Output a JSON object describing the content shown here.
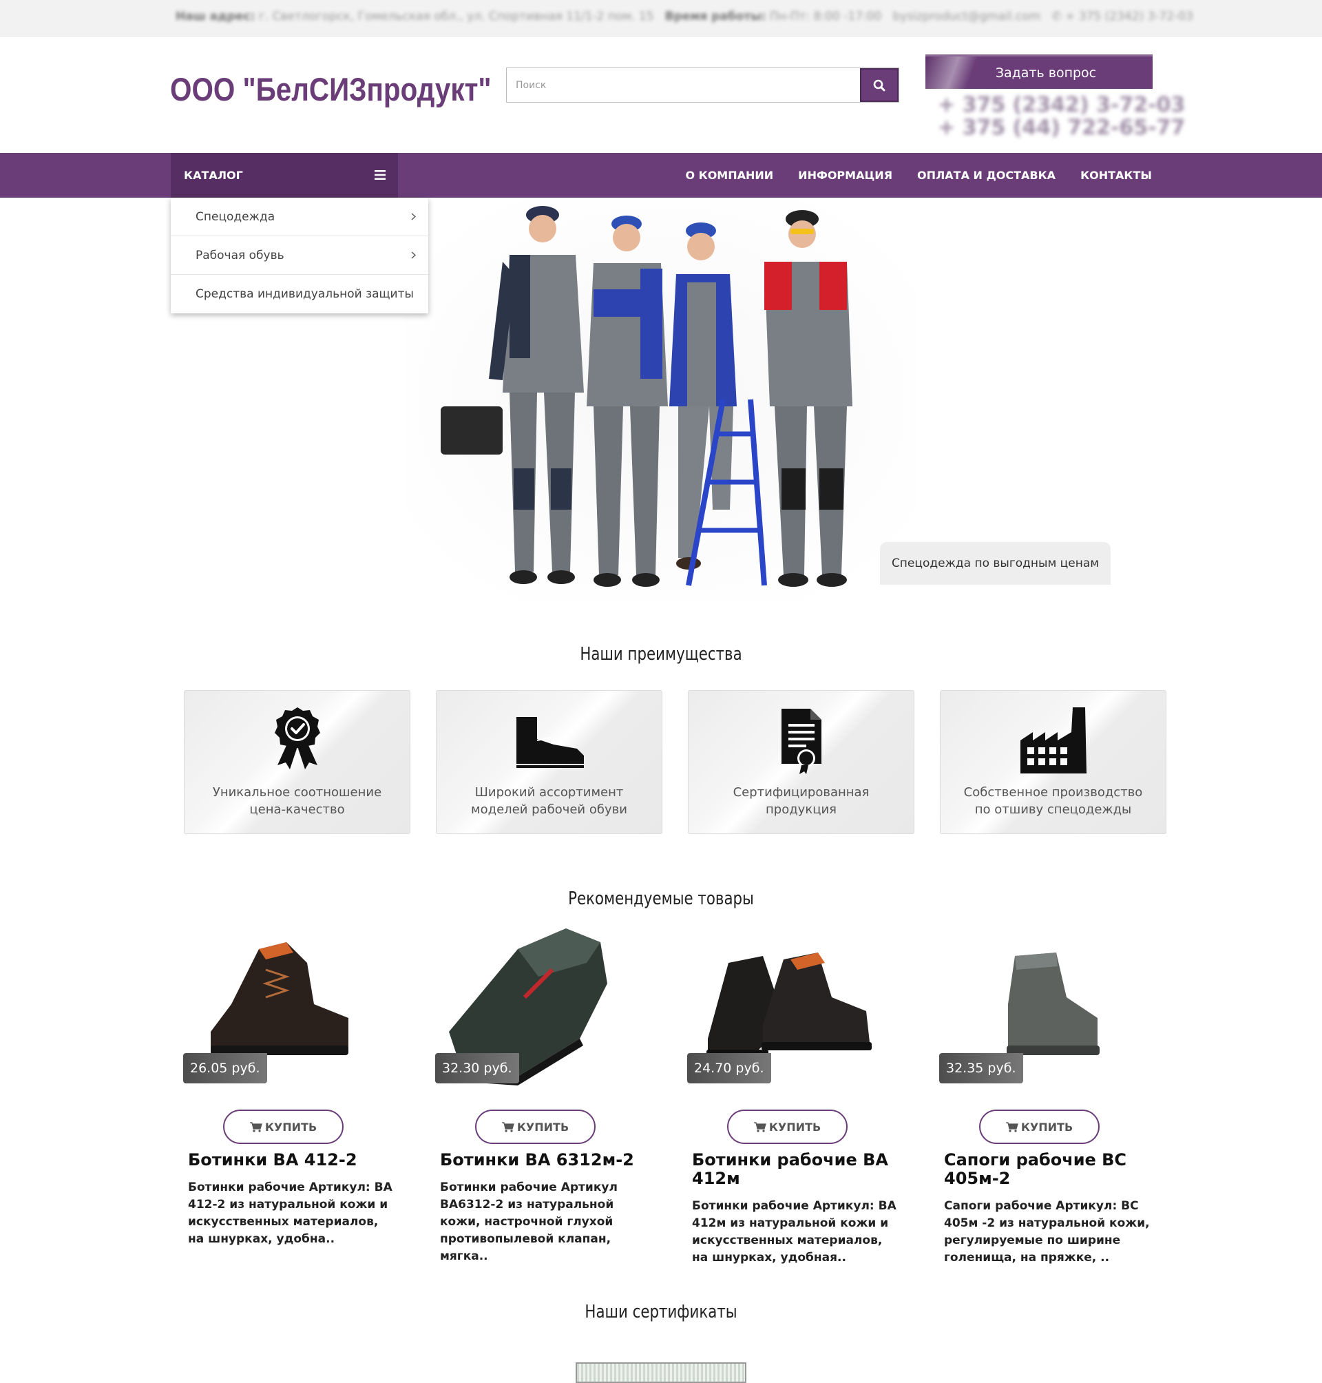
{
  "topbar": {
    "address_label": "Наш адрес:",
    "address": "г. Светлогорск, Гомельская обл., ул. Спортивная 11/1-2 пом. 15",
    "hours_label": "Время работы:",
    "hours": "Пн-Пт: 8:00 -17:00",
    "email": "bysizproduct@gmail.com",
    "phone": "+ 375 (2342) 3-72-03"
  },
  "header": {
    "logo": "ООО \"БелСИЗпродукт\"",
    "search_placeholder": "Поиск",
    "ask_button": "Задать вопрос",
    "phones": [
      "+ 375 (2342) 3-72-03",
      "+ 375 (44) 722-65-77"
    ]
  },
  "nav": {
    "catalog": "КАТАЛОГ",
    "links": [
      "О КОМПАНИИ",
      "ИНФОРМАЦИЯ",
      "ОПЛАТА И ДОСТАВКА",
      "КОНТАКТЫ"
    ]
  },
  "catalog_menu": [
    "Спецодежда",
    "Рабочая обувь",
    "Средства индивидуальной защиты"
  ],
  "hero": {
    "caption": "Спецодежда по выгодным ценам"
  },
  "advantages": {
    "title": "Наши преимущества",
    "items": [
      {
        "icon": "award-ribbon-icon",
        "line1": "Уникальное соотношение",
        "line2": "цена-качество"
      },
      {
        "icon": "boot-icon",
        "line1": "Широкий ассортимент",
        "line2": "моделей рабочей обуви"
      },
      {
        "icon": "certificate-icon",
        "line1": "Сертифицированная",
        "line2": "продукция"
      },
      {
        "icon": "factory-icon",
        "line1": "Собственное производство",
        "line2": "по отшиву спецодежды"
      }
    ]
  },
  "products": {
    "title": "Рекомендуемые товары",
    "buy_label": "КУПИТЬ",
    "items": [
      {
        "price": "26.05 руб.",
        "name": "Ботинки ВА 412-2",
        "desc": "Ботинки рабочие Артикул: ВА 412-2 из натуральной кожи и искусственных материалов, на шнурках, удобна.."
      },
      {
        "price": "32.30 руб.",
        "name": "Ботинки ВА 6312м-2",
        "desc": "Ботинки рабочие Артикул ВА6312-2 из натуральной кожи, настрочной глухой противопылевой клапан, мягка.."
      },
      {
        "price": "24.70 руб.",
        "name": "Ботинки рабочие ВА 412м",
        "desc": "Ботинки рабочие Артикул: ВА 412м из натуральной кожи и искусственных материалов, на шнурках, удобная.."
      },
      {
        "price": "32.35 руб.",
        "name": "Сапоги рабочие ВС 405м-2",
        "desc": "Сапоги рабочие Артикул: ВС 405м -2 из натуральной кожи, регулируемые по ширине голенища, на пряжке, .."
      }
    ]
  },
  "certificates": {
    "title": "Наши сертификаты"
  },
  "colors": {
    "brand": "#6a3d78",
    "brand_dark": "#562e63"
  }
}
